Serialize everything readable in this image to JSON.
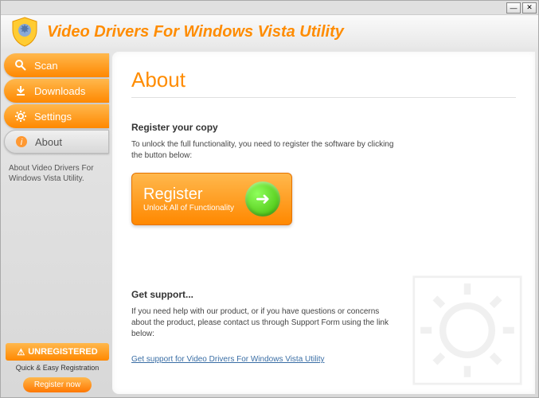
{
  "app": {
    "title": "Video Drivers For Windows Vista Utility"
  },
  "nav": {
    "items": [
      {
        "label": "Scan"
      },
      {
        "label": "Downloads"
      },
      {
        "label": "Settings"
      },
      {
        "label": "About"
      }
    ]
  },
  "sidebar": {
    "description": "About Video Drivers For Windows Vista Utility.",
    "unregistered": "UNREGISTERED",
    "quick": "Quick & Easy Registration",
    "register_now": "Register now"
  },
  "page": {
    "title": "About",
    "register": {
      "heading": "Register your copy",
      "text": "To unlock the full functionality, you need to register the software by clicking the button below:",
      "button_main": "Register",
      "button_sub": "Unlock All of Functionality"
    },
    "support": {
      "heading": "Get support...",
      "text": "If you need help with our product, or if you have questions or concerns about the product, please contact us through Support Form using the link below:",
      "link": "Get support for Video Drivers For Windows Vista Utility"
    }
  }
}
